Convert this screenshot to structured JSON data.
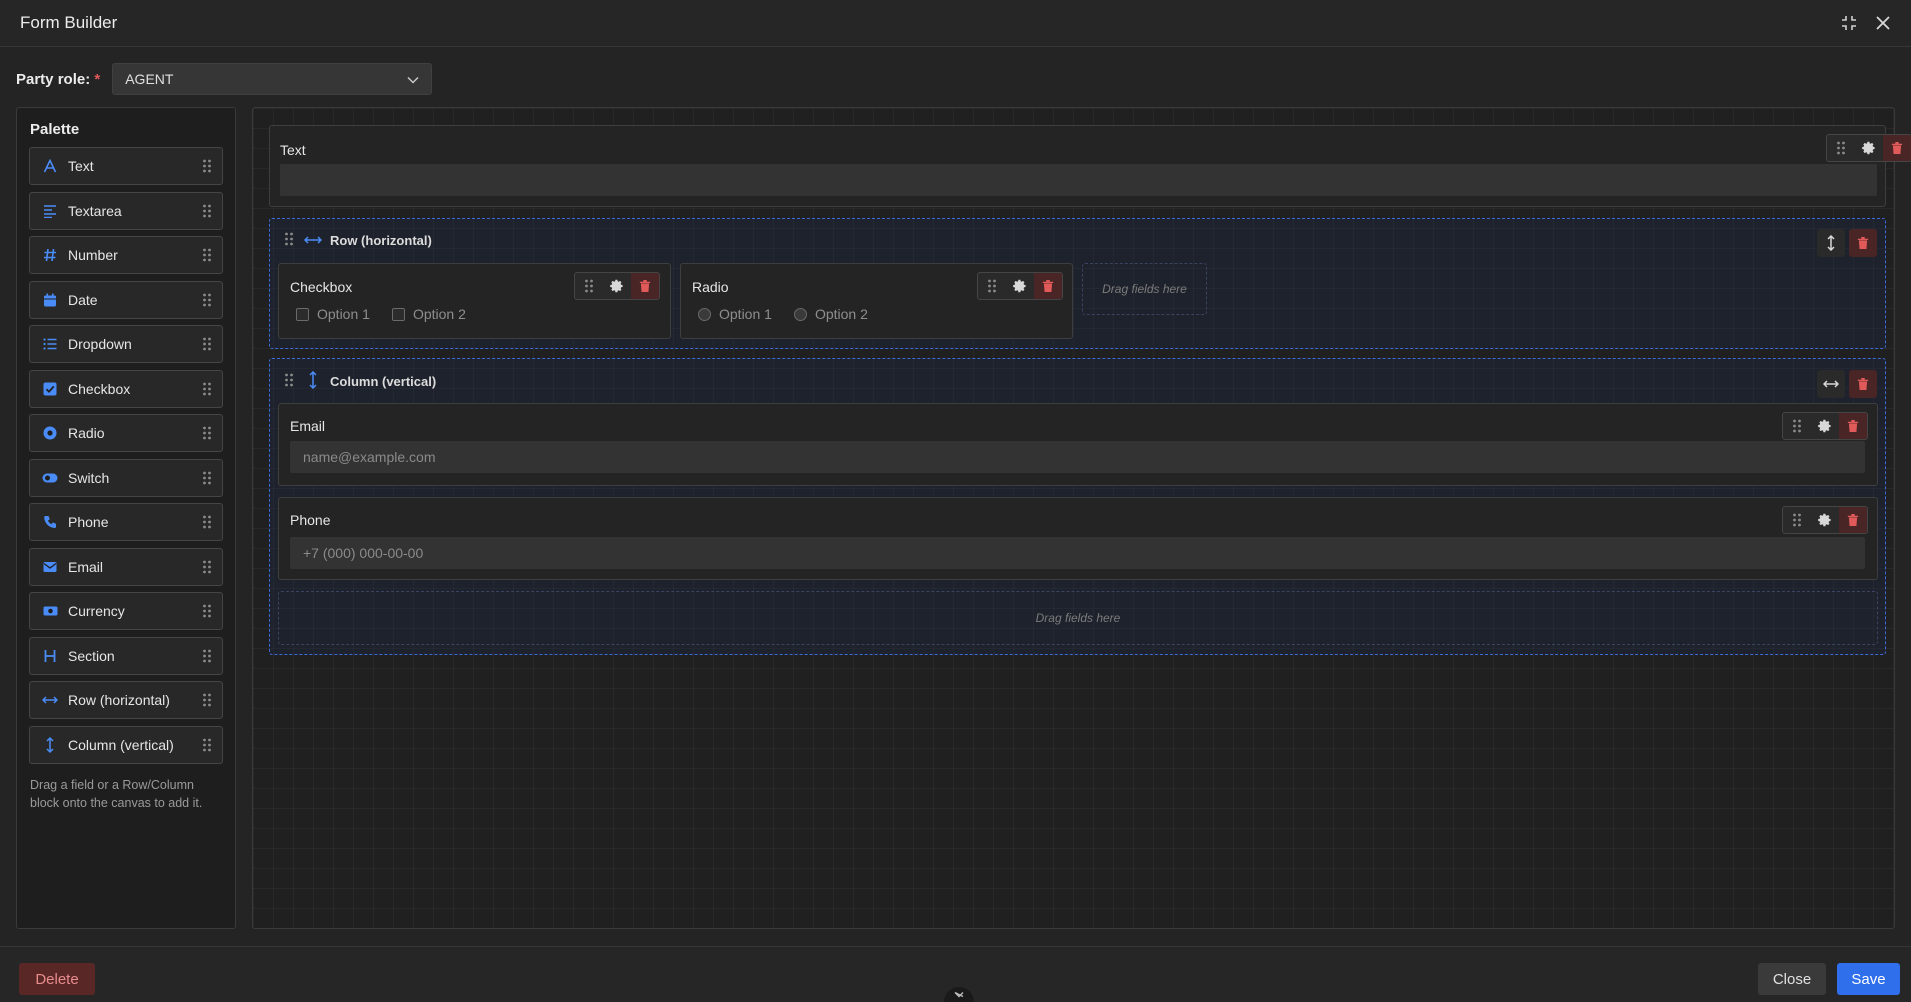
{
  "header": {
    "title": "Form Builder"
  },
  "role": {
    "label": "Party role:",
    "required_mark": "*",
    "value": "AGENT"
  },
  "palette": {
    "title": "Palette",
    "items": [
      {
        "label": "Text",
        "icon": "text-icon"
      },
      {
        "label": "Textarea",
        "icon": "textarea-icon"
      },
      {
        "label": "Number",
        "icon": "hash-icon"
      },
      {
        "label": "Date",
        "icon": "calendar-icon"
      },
      {
        "label": "Dropdown",
        "icon": "list-icon"
      },
      {
        "label": "Checkbox",
        "icon": "checkbox-icon"
      },
      {
        "label": "Radio",
        "icon": "radio-icon"
      },
      {
        "label": "Switch",
        "icon": "toggle-icon"
      },
      {
        "label": "Phone",
        "icon": "phone-icon"
      },
      {
        "label": "Email",
        "icon": "envelope-icon"
      },
      {
        "label": "Currency",
        "icon": "money-icon"
      },
      {
        "label": "Section",
        "icon": "heading-icon"
      },
      {
        "label": "Row (horizontal)",
        "icon": "arrows-horizontal-icon"
      },
      {
        "label": "Column (vertical)",
        "icon": "arrows-vertical-icon"
      }
    ],
    "hint_line1": "Drag a field or a Row/Column",
    "hint_line2": "block onto the canvas to add it."
  },
  "canvas": {
    "text_field": {
      "label": "Text"
    },
    "row_block": {
      "title": "Row (horizontal)",
      "checkbox": {
        "label": "Checkbox",
        "options": [
          "Option 1",
          "Option 2"
        ]
      },
      "radio": {
        "label": "Radio",
        "options": [
          "Option 1",
          "Option 2"
        ]
      },
      "dropzone": "Drag fields here"
    },
    "column_block": {
      "title": "Column (vertical)",
      "email": {
        "label": "Email",
        "placeholder": "name@example.com"
      },
      "phone": {
        "label": "Phone",
        "placeholder": "+7 (000) 000-00-00"
      },
      "dropzone": "Drag fields here"
    }
  },
  "footer": {
    "delete": "Delete",
    "close": "Close",
    "save": "Save"
  },
  "colors": {
    "accent": "#2f6fec",
    "danger": "#e05a5a",
    "icon_blue": "#3b82f6"
  }
}
